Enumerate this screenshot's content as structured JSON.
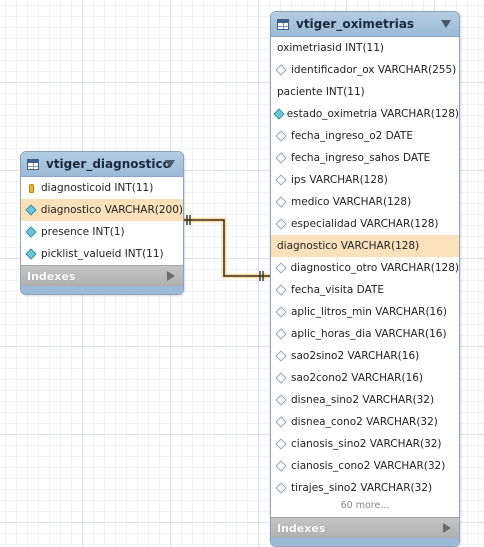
{
  "entities": {
    "diagnostico": {
      "title": "vtiger_diagnostico",
      "columns": [
        {
          "text": "diagnosticoid INT(11)",
          "icon": "key"
        },
        {
          "text": "diagnostico VARCHAR(200)",
          "icon": "diamond-filled"
        },
        {
          "text": "presence INT(1)",
          "icon": "diamond-filled"
        },
        {
          "text": "picklist_valueid INT(11)",
          "icon": "diamond-filled"
        }
      ],
      "indexes_label": "Indexes"
    },
    "oximetrias": {
      "title": "vtiger_oximetrias",
      "columns": [
        {
          "text": "oximetriasid INT(11)",
          "icon": "none"
        },
        {
          "text": "identificador_ox VARCHAR(255)",
          "icon": "diamond-hollow"
        },
        {
          "text": "paciente INT(11)",
          "icon": "none"
        },
        {
          "text": "estado_oximetria VARCHAR(128)",
          "icon": "diamond-filled"
        },
        {
          "text": "fecha_ingreso_o2 DATE",
          "icon": "diamond-hollow"
        },
        {
          "text": "fecha_ingreso_sahos DATE",
          "icon": "diamond-hollow"
        },
        {
          "text": "ips VARCHAR(128)",
          "icon": "diamond-hollow"
        },
        {
          "text": "medico VARCHAR(128)",
          "icon": "diamond-hollow"
        },
        {
          "text": "especialidad VARCHAR(128)",
          "icon": "diamond-hollow"
        },
        {
          "text": "diagnostico VARCHAR(128)",
          "icon": "none"
        },
        {
          "text": "diagnostico_otro VARCHAR(128)",
          "icon": "diamond-hollow"
        },
        {
          "text": "fecha_visita DATE",
          "icon": "diamond-hollow"
        },
        {
          "text": "aplic_litros_min VARCHAR(16)",
          "icon": "diamond-hollow"
        },
        {
          "text": "aplic_horas_dia VARCHAR(16)",
          "icon": "diamond-hollow"
        },
        {
          "text": "sao2sino2 VARCHAR(16)",
          "icon": "diamond-hollow"
        },
        {
          "text": "sao2cono2 VARCHAR(16)",
          "icon": "diamond-hollow"
        },
        {
          "text": "disnea_sino2 VARCHAR(32)",
          "icon": "diamond-hollow"
        },
        {
          "text": "disnea_cono2 VARCHAR(32)",
          "icon": "diamond-hollow"
        },
        {
          "text": "cianosis_sino2 VARCHAR(32)",
          "icon": "diamond-hollow"
        },
        {
          "text": "cianosis_cono2 VARCHAR(32)",
          "icon": "diamond-hollow"
        },
        {
          "text": "tirajes_sino2 VARCHAR(32)",
          "icon": "diamond-hollow"
        }
      ],
      "more_label": "60 more...",
      "indexes_label": "Indexes"
    }
  },
  "colors": {
    "header": "#9bbad7",
    "highlight_row": "#fbe1bb",
    "relationship_line": "#c98a1a"
  }
}
